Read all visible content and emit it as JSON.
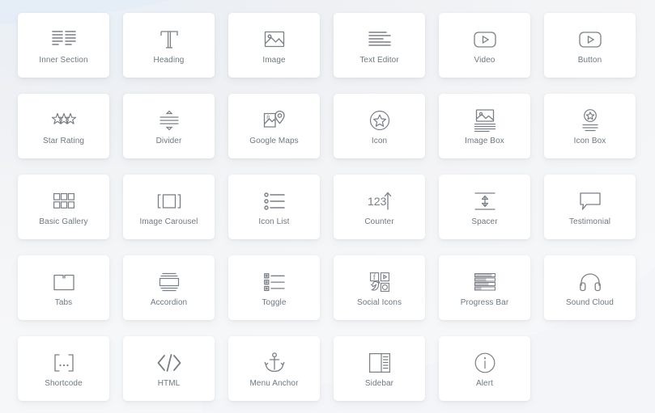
{
  "panel": {
    "title": "Elementor Widgets Panel",
    "background_color": "#f1f2f4",
    "card_color": "#ffffff",
    "label_color": "#6d7882",
    "icon_color": "#7a7f86",
    "accent_tint": "#e9f0f7",
    "columns": 6
  },
  "widgets": [
    {
      "label": "Inner Section",
      "icon": "inner-section-icon"
    },
    {
      "label": "Heading",
      "icon": "heading-t-icon"
    },
    {
      "label": "Image",
      "icon": "image-icon"
    },
    {
      "label": "Text Editor",
      "icon": "text-editor-icon"
    },
    {
      "label": "Video",
      "icon": "video-play-icon"
    },
    {
      "label": "Button",
      "icon": "button-play-icon"
    },
    {
      "label": "Star Rating",
      "icon": "star-rating-icon"
    },
    {
      "label": "Divider",
      "icon": "divider-icon"
    },
    {
      "label": "Google Maps",
      "icon": "google-maps-icon"
    },
    {
      "label": "Icon",
      "icon": "icon-circle-star-icon"
    },
    {
      "label": "Image Box",
      "icon": "image-box-icon"
    },
    {
      "label": "Icon Box",
      "icon": "icon-box-icon"
    },
    {
      "label": "Basic Gallery",
      "icon": "basic-gallery-icon"
    },
    {
      "label": "Image Carousel",
      "icon": "image-carousel-icon"
    },
    {
      "label": "Icon List",
      "icon": "icon-list-icon"
    },
    {
      "label": "Counter",
      "icon": "counter-icon"
    },
    {
      "label": "Spacer",
      "icon": "spacer-icon"
    },
    {
      "label": "Testimonial",
      "icon": "testimonial-quote-icon"
    },
    {
      "label": "Tabs",
      "icon": "tabs-folder-icon"
    },
    {
      "label": "Accordion",
      "icon": "accordion-icon"
    },
    {
      "label": "Toggle",
      "icon": "toggle-list-icon"
    },
    {
      "label": "Social Icons",
      "icon": "social-icons-icon"
    },
    {
      "label": "Progress Bar",
      "icon": "progress-bar-icon"
    },
    {
      "label": "Sound Cloud",
      "icon": "sound-cloud-headphones-icon"
    },
    {
      "label": "Shortcode",
      "icon": "shortcode-brackets-icon"
    },
    {
      "label": "HTML",
      "icon": "html-code-icon"
    },
    {
      "label": "Menu Anchor",
      "icon": "menu-anchor-icon"
    },
    {
      "label": "Sidebar",
      "icon": "sidebar-icon"
    },
    {
      "label": "Alert",
      "icon": "alert-info-icon"
    }
  ]
}
